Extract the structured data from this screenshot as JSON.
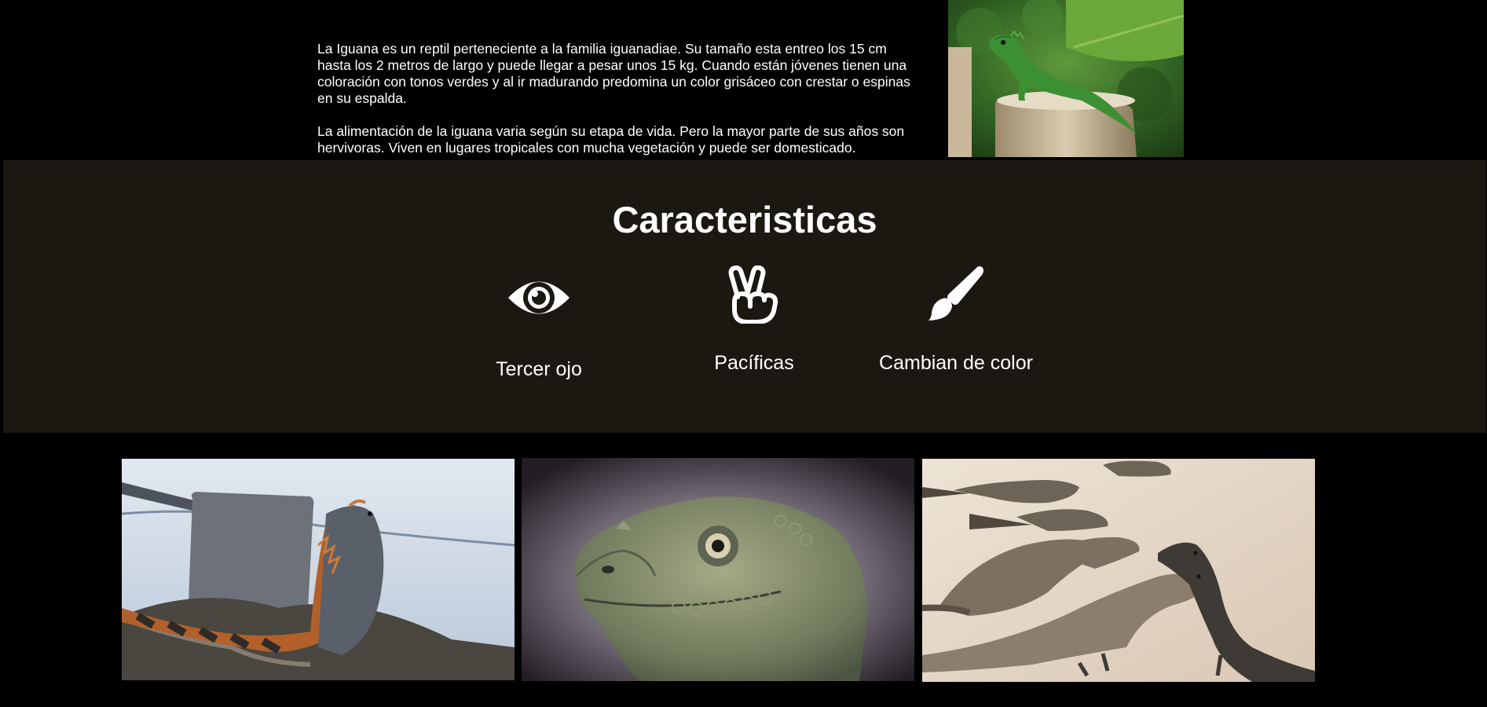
{
  "intro": {
    "paragraph_1": "La Iguana es un reptil perteneciente a la familia iguanadiae. Su tamaño esta entreo los 15 cm hasta los 2 metros de largo y puede llegar a pesar unos 15 kg. Cuando están jóvenes tienen una coloración con tonos verdes y al ir madurando predomina un color grisáceo con crestar o espinas en su espalda.",
    "paragraph_2": "La alimentación de la iguana varia según su etapa de vida. Pero la mayor parte de sus años son hervivoras. Viven en lugares tropicales con mucha vegetación y puede ser domesticado."
  },
  "features": {
    "title": "Caracteristicas",
    "items": [
      {
        "icon": "eye-icon",
        "label": "Tercer ojo"
      },
      {
        "icon": "peace-hand-icon",
        "label": "Pacíficas"
      },
      {
        "icon": "paintbrush-icon",
        "label": "Cambian de color"
      }
    ]
  },
  "colors": {
    "page_background": "#000000",
    "features_background": "#1b1812",
    "text": "#ffffff"
  }
}
